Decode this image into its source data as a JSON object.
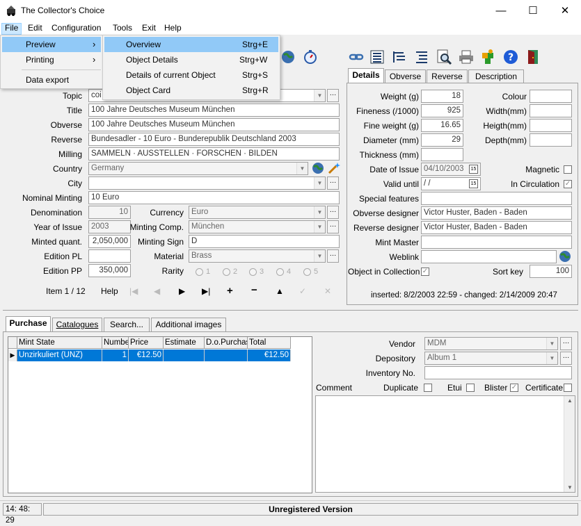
{
  "window": {
    "title": "The Collector's Choice",
    "min": "—",
    "max": "☐",
    "close": "✕"
  },
  "menu": [
    "File",
    "Edit",
    "Configuration",
    "Tools",
    "Exit",
    "Help"
  ],
  "file_menu": {
    "preview": "Preview",
    "printing": "Printing",
    "data_export": "Data export",
    "arrow": "›"
  },
  "preview_submenu": [
    {
      "label": "Overview",
      "shortcut": "Strg+E"
    },
    {
      "label": "Object Details",
      "shortcut": "Strg+W"
    },
    {
      "label": "Details of current Object",
      "shortcut": "Strg+S"
    },
    {
      "label": "Object Card",
      "shortcut": "Strg+R"
    }
  ],
  "left": {
    "topic_label": "Topic",
    "topic_value": "coi",
    "title_label": "Title",
    "title_value": "100 Jahre Deutsches Museum München",
    "obverse_label": "Obverse",
    "obverse_value": "100 Jahre Deutsches Museum München",
    "reverse_label": "Reverse",
    "reverse_value": "Bundesadler - 10 Euro - Bunderepublik Deutschland 2003",
    "milling_label": "Milling",
    "milling_value": "SAMMELN · AUSSTELLEN · FORSCHEN · BILDEN",
    "country_label": "Country",
    "country_value": "Germany",
    "city_label": "City",
    "city_value": "",
    "nominal_label": "Nominal Minting",
    "nominal_value": "10 Euro",
    "denomination_label": "Denomination",
    "denomination_value": "10",
    "currency_label": "Currency",
    "currency_value": "Euro",
    "year_label": "Year of Issue",
    "year_value": "2003",
    "minting_comp_label": "Minting Comp.",
    "minting_comp_value": "München",
    "minted_label": "Minted quant.",
    "minted_value": "2,050,000",
    "minting_sign_label": "Minting Sign",
    "minting_sign_value": "D",
    "edition_pl_label": "Edition PL",
    "edition_pl_value": "",
    "material_label": "Material",
    "material_value": "Brass",
    "edition_pp_label": "Edition PP",
    "edition_pp_value": "350,000",
    "rarity_label": "Rarity",
    "rarity": [
      "1",
      "2",
      "3",
      "4",
      "5"
    ],
    "item_counter": "Item 1 / 12",
    "help": "Help"
  },
  "right_tabs": [
    "Details",
    "Obverse",
    "Reverse",
    "Description"
  ],
  "details": {
    "weight_label": "Weight (g)",
    "weight": "18",
    "fineness_label": "Fineness (/1000)",
    "fineness": "925",
    "fine_weight_label": "Fine weight (g)",
    "fine_weight": "16.65",
    "diameter_label": "Diameter (mm)",
    "diameter": "29",
    "thickness_label": "Thickness (mm)",
    "thickness": "",
    "colour_label": "Colour",
    "width_label": "Width(mm)",
    "height_label": "Heigth(mm)",
    "depth_label": "Depth(mm)",
    "date_issue_label": "Date of Issue",
    "date_issue": "04/10/2003",
    "valid_until_label": "Valid until",
    "valid_until": " /  /",
    "magnetic_label": "Magnetic",
    "circulation_label": "In Circulation",
    "special_label": "Special features",
    "special": "",
    "obv_designer_label": "Obverse designer",
    "obv_designer": "Victor Huster, Baden - Baden",
    "rev_designer_label": "Reverse designer",
    "rev_designer": "Victor Huster, Baden - Baden",
    "mint_master_label": "Mint Master",
    "mint_master": "",
    "weblink_label": "Weblink",
    "weblink": "",
    "in_collection_label": "Object in Collection",
    "sort_key_label": "Sort key",
    "sort_key": "100",
    "timestamps": "inserted: 8/2/2003 22:59 - changed: 2/14/2009 20:47"
  },
  "bottom_tabs": [
    "Purchase",
    "Catalogues",
    "Search...",
    "Additional images"
  ],
  "grid": {
    "headers": [
      "Mint State",
      "Numbe",
      "Price",
      "Estimate",
      "D.o.Purchas",
      "Total"
    ],
    "rows": [
      [
        "Unzirkuliert (UNZ)",
        "1",
        "€12.50",
        "",
        "",
        "€12.50"
      ]
    ]
  },
  "purchase": {
    "vendor_label": "Vendor",
    "vendor": "MDM",
    "depository_label": "Depository",
    "depository": "Album 1",
    "inventory_label": "Inventory No.",
    "inventory": "",
    "comment_label": "Comment",
    "duplicate_label": "Duplicate",
    "etui_label": "Etui",
    "blister_label": "Blister",
    "certificate_label": "Certificate"
  },
  "status": {
    "time": "14: 48: 29",
    "message": "Unregistered Version"
  }
}
